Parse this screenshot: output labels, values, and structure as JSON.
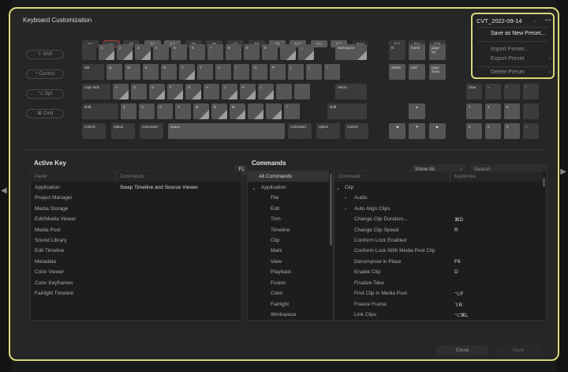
{
  "window": {
    "title": "Keyboard Customization"
  },
  "preset": {
    "current": "CVT_2022-09-14",
    "menu": [
      {
        "label": "Save as New Preset...",
        "active": true,
        "submenu": false
      },
      {
        "label": "Import Preset...",
        "active": false,
        "submenu": false
      },
      {
        "label": "Export Preset",
        "active": false,
        "submenu": true
      },
      {
        "label": "Delete Preset",
        "active": false,
        "submenu": true
      }
    ],
    "more_label": "•••"
  },
  "modifiers": [
    "⇧ Shift",
    "^ Control",
    "⌥ Opt",
    "⌘ Cmd"
  ],
  "keyboard": {
    "fkeys": [
      "esc",
      "F1",
      "F2",
      "F3",
      "F4",
      "F5",
      "F6",
      "F7",
      "F8",
      "F9",
      "F10",
      "F11",
      "F12",
      "eject"
    ],
    "row1": [
      "`",
      "1",
      "2",
      "3",
      "4",
      "5",
      "6",
      "7",
      "8",
      "9",
      "0",
      "-",
      "=",
      "backspace"
    ],
    "row2": [
      "tab",
      "Q",
      "W",
      "E",
      "R",
      "T",
      "Y",
      "U",
      "I",
      "O",
      "P",
      "[",
      "]",
      "\\"
    ],
    "row3": [
      "caps lock",
      "A",
      "S",
      "D",
      "F",
      "G",
      "H",
      "J",
      "K",
      "L",
      ";",
      "'",
      "return"
    ],
    "row4": [
      "shift",
      "Z",
      "X",
      "C",
      "V",
      "B",
      "N",
      "M",
      ",",
      ".",
      "/",
      "shift"
    ],
    "row5": [
      "control",
      "option",
      "command",
      "space",
      "command",
      "option",
      "control"
    ],
    "nav_f": [
      "F13",
      "F14",
      "F15"
    ],
    "nav": [
      "fn",
      "home",
      "page up",
      "delete",
      "end",
      "page down"
    ],
    "arrows": [
      "▲",
      "◀",
      "▼",
      "▶"
    ],
    "numpad": [
      "clear",
      "=",
      "/",
      "*",
      "7",
      "8",
      "9",
      "-",
      "4",
      "5",
      "6",
      "+",
      "1",
      "2",
      "3",
      "enter",
      "0",
      "."
    ]
  },
  "active_key": {
    "title": "Active Key",
    "key_label": "F1",
    "columns": [
      "Panel",
      "Commands"
    ],
    "rows": [
      {
        "panel": "Application",
        "command": "Swap Timeline and Source Viewer"
      },
      {
        "panel": "Project Manager",
        "command": ""
      },
      {
        "panel": "Media Storage",
        "command": ""
      },
      {
        "panel": "Edit/Media Viewer",
        "command": ""
      },
      {
        "panel": "Media Pool",
        "command": ""
      },
      {
        "panel": "Sound Library",
        "command": ""
      },
      {
        "panel": "Edit Timeline",
        "command": ""
      },
      {
        "panel": "Metadata",
        "command": ""
      },
      {
        "panel": "Color Viewer",
        "command": ""
      },
      {
        "panel": "Color Keyframes",
        "command": ""
      },
      {
        "panel": "Fairlight Timeline",
        "command": ""
      }
    ]
  },
  "commands": {
    "title": "Commands",
    "filter": "Show All",
    "search_placeholder": "Search",
    "tree": [
      "All Commands",
      "Application",
      "File",
      "Edit",
      "Trim",
      "Timeline",
      "Clip",
      "Mark",
      "View",
      "Playback",
      "Fusion",
      "Color",
      "Fairlight",
      "Workspace"
    ],
    "columns": [
      "Command",
      "Keystroke"
    ],
    "rows": [
      {
        "command": "Clip",
        "key": ""
      },
      {
        "command": "Audio",
        "key": ""
      },
      {
        "command": "Auto Align Clips",
        "key": ""
      },
      {
        "command": "Change Clip Duration...",
        "key": "⌘D"
      },
      {
        "command": "Change Clip Speed",
        "key": "R"
      },
      {
        "command": "Conform Lock Enabled",
        "key": ""
      },
      {
        "command": "Conform Lock With Media Pool Clip",
        "key": ""
      },
      {
        "command": "Decompose in Place",
        "key": "F6"
      },
      {
        "command": "Enable Clip",
        "key": "D"
      },
      {
        "command": "Finalize Take",
        "key": ""
      },
      {
        "command": "Find Clip in Media Pool",
        "key": "⌥F"
      },
      {
        "command": "Freeze Frame",
        "key": "⇧R"
      },
      {
        "command": "Link Clips",
        "key": "⌥⌘L"
      }
    ]
  },
  "buttons": {
    "close": "Close",
    "save": "Save"
  }
}
